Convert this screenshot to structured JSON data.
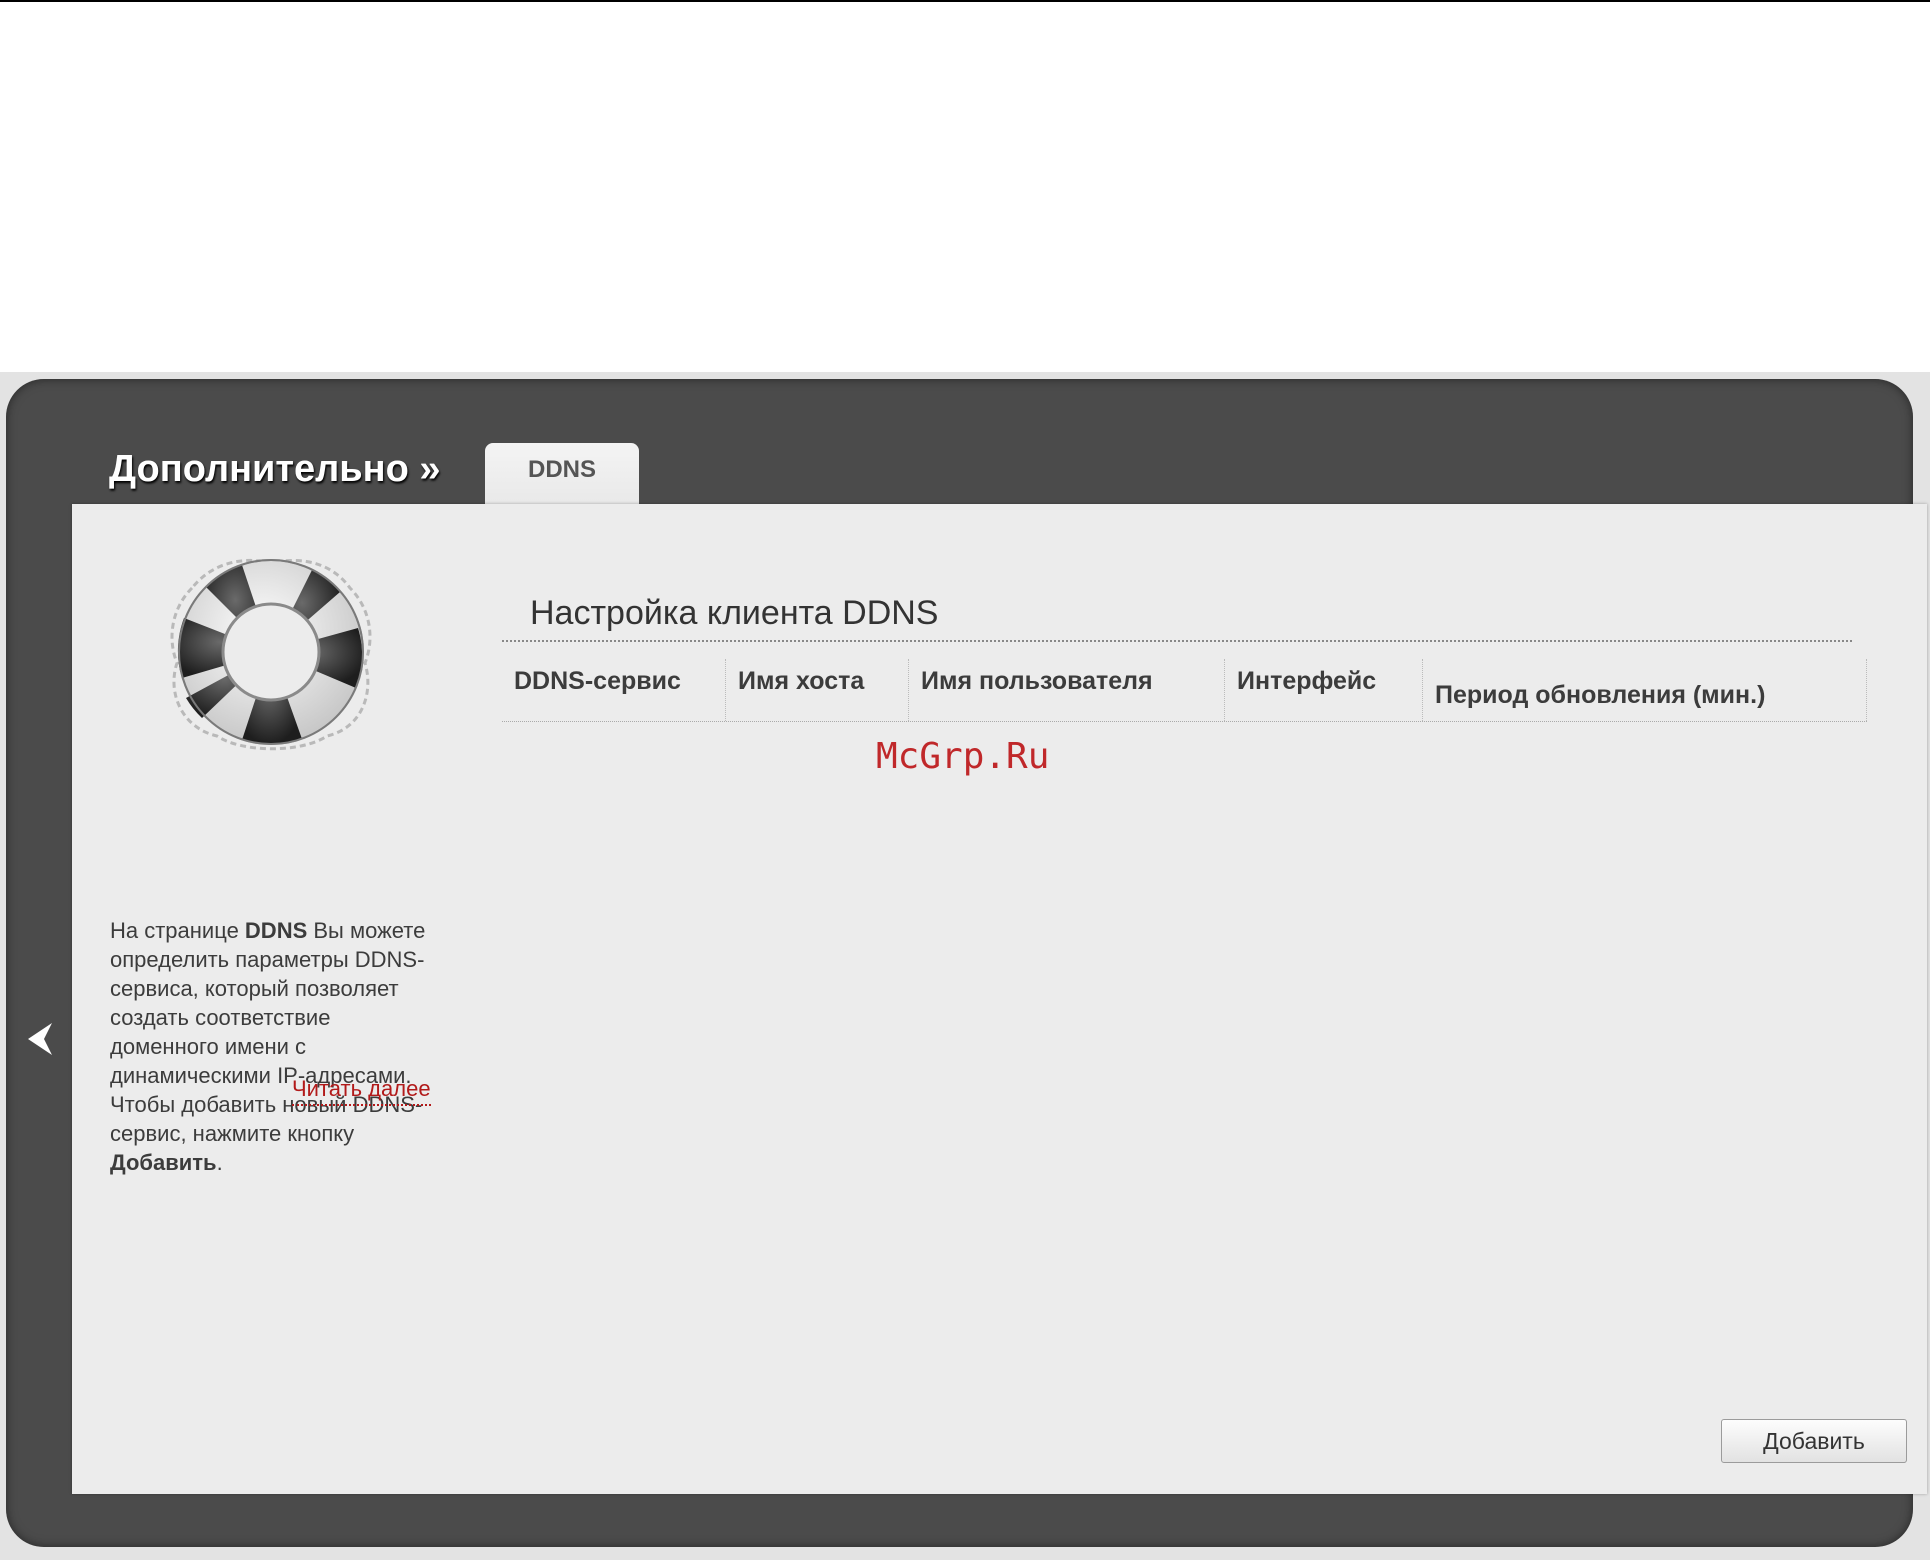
{
  "header": {
    "section_title": "Дополнительно »",
    "active_tab": "DDNS"
  },
  "sidebar": {
    "help_parts": {
      "p1": "На странице ",
      "p2": "DDNS",
      "p3": " Вы можете определить параметры DDNS-сервиса, который позволяет создать соответствие доменного имени с динамическими IP-адресами. Чтобы добавить новый DDNS-сервис, нажмите кнопку ",
      "p4": "Добавить",
      "p5": "."
    },
    "read_more": "Читать далее"
  },
  "main": {
    "table_title": "Настройка клиента DDNS",
    "columns": [
      "DDNS-сервис",
      "Имя хоста",
      "Имя пользователя",
      "Интерфейс",
      "Период обновления (мин.)"
    ],
    "rows": [],
    "add_button": "Добавить"
  },
  "watermark": "McGrp.Ru",
  "colors": {
    "panel_dark": "#4b4b4b",
    "content_bg": "#ececec",
    "link_red": "#b21a1a",
    "watermark_red": "#c0282a"
  },
  "icons": {
    "back": "chevron-left-icon",
    "help": "lifebuoy-icon"
  }
}
